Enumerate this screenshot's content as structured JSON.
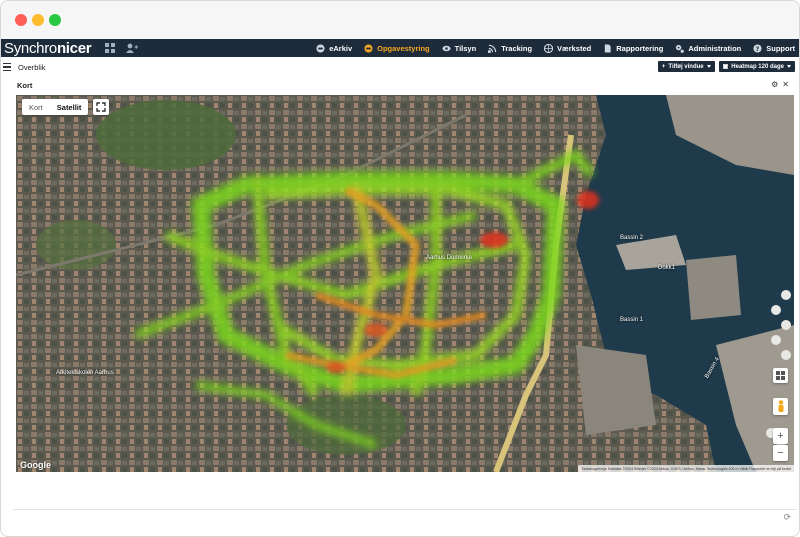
{
  "app": {
    "brand_prefix": "Synchro",
    "brand_suffix": "nicer"
  },
  "nav": {
    "items": [
      {
        "label": "eArkiv",
        "icon": "archive-icon",
        "active": false
      },
      {
        "label": "Opgavestyring",
        "icon": "tasks-icon",
        "active": true
      },
      {
        "label": "Tilsyn",
        "icon": "eye-icon",
        "active": false
      },
      {
        "label": "Tracking",
        "icon": "rss-icon",
        "active": false
      },
      {
        "label": "Værksted",
        "icon": "globe-wrench-icon",
        "active": false
      },
      {
        "label": "Rapportering",
        "icon": "document-icon",
        "active": false
      },
      {
        "label": "Administration",
        "icon": "cogs-icon",
        "active": false
      },
      {
        "label": "Support",
        "icon": "help-icon",
        "active": false
      }
    ],
    "accent": "#f5a623",
    "background": "#1d2b3a"
  },
  "subbar": {
    "breadcrumb": "Overblik",
    "add_window_label": "Tilføj vindue",
    "heatmap_label": "Heatmap 120 dage"
  },
  "panel": {
    "title": "Kort",
    "settings_icon": "gear-icon",
    "close_icon": "close-icon"
  },
  "map": {
    "type_options": [
      "Kort",
      "Satellit"
    ],
    "selected_type": "Satellit",
    "zoom_in": "+",
    "zoom_out": "−",
    "logo": "Google",
    "attribution": "Tastaturgenveje  Kortdata ©2024 Billeder ©2024 Airbus, CNES / Airbus, Maxar Technologies  100 m  Vilkår  Rapportér en fejl på kortet",
    "labels": [
      "Bassin 2",
      "Bassin 1",
      "Bassin 4",
      "Dokk1",
      "Aarhus Domkirke",
      "Arkitektskolen Aarhus"
    ]
  }
}
